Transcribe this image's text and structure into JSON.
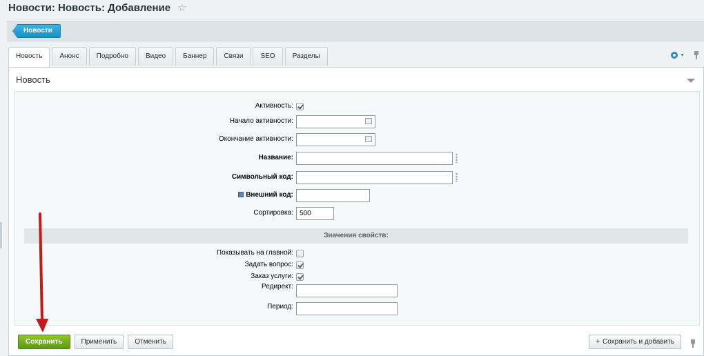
{
  "page": {
    "title": "Новости: Новость: Добавление"
  },
  "toolbar": {
    "back_label": "Новости"
  },
  "tabs": [
    {
      "label": "Новость",
      "active": true
    },
    {
      "label": "Анонс"
    },
    {
      "label": "Подробно"
    },
    {
      "label": "Видео"
    },
    {
      "label": "Баннер"
    },
    {
      "label": "Связи"
    },
    {
      "label": "SEO"
    },
    {
      "label": "Разделы"
    }
  ],
  "section": {
    "title": "Новость"
  },
  "fields": {
    "active": {
      "label": "Активность:",
      "checked": true
    },
    "start": {
      "label": "Начало активности:",
      "value": ""
    },
    "end": {
      "label": "Окончание активности:",
      "value": ""
    },
    "name": {
      "label": "Название:",
      "value": ""
    },
    "code": {
      "label": "Символьный код:",
      "value": ""
    },
    "external": {
      "label": "Внешний код:",
      "value": ""
    },
    "sort": {
      "label": "Сортировка:",
      "value": "500"
    }
  },
  "properties": {
    "header": "Значения свойств:",
    "show_main": {
      "label": "Показывать на главной:",
      "checked": false
    },
    "ask_question": {
      "label": "Задать вопрос:",
      "checked": true
    },
    "order_service": {
      "label": "Заказ услуги:",
      "checked": true
    },
    "redirect": {
      "label": "Редирект:",
      "value": ""
    },
    "period": {
      "label": "Период:",
      "value": ""
    }
  },
  "buttons": {
    "save": "Сохранить",
    "apply": "Применить",
    "cancel": "Отменить",
    "save_add": "Сохранить и добавить"
  },
  "colors": {
    "accent_blue": "#1590c6",
    "save_green": "#6aa81a",
    "annotation_arrow": "#c41a1a"
  }
}
